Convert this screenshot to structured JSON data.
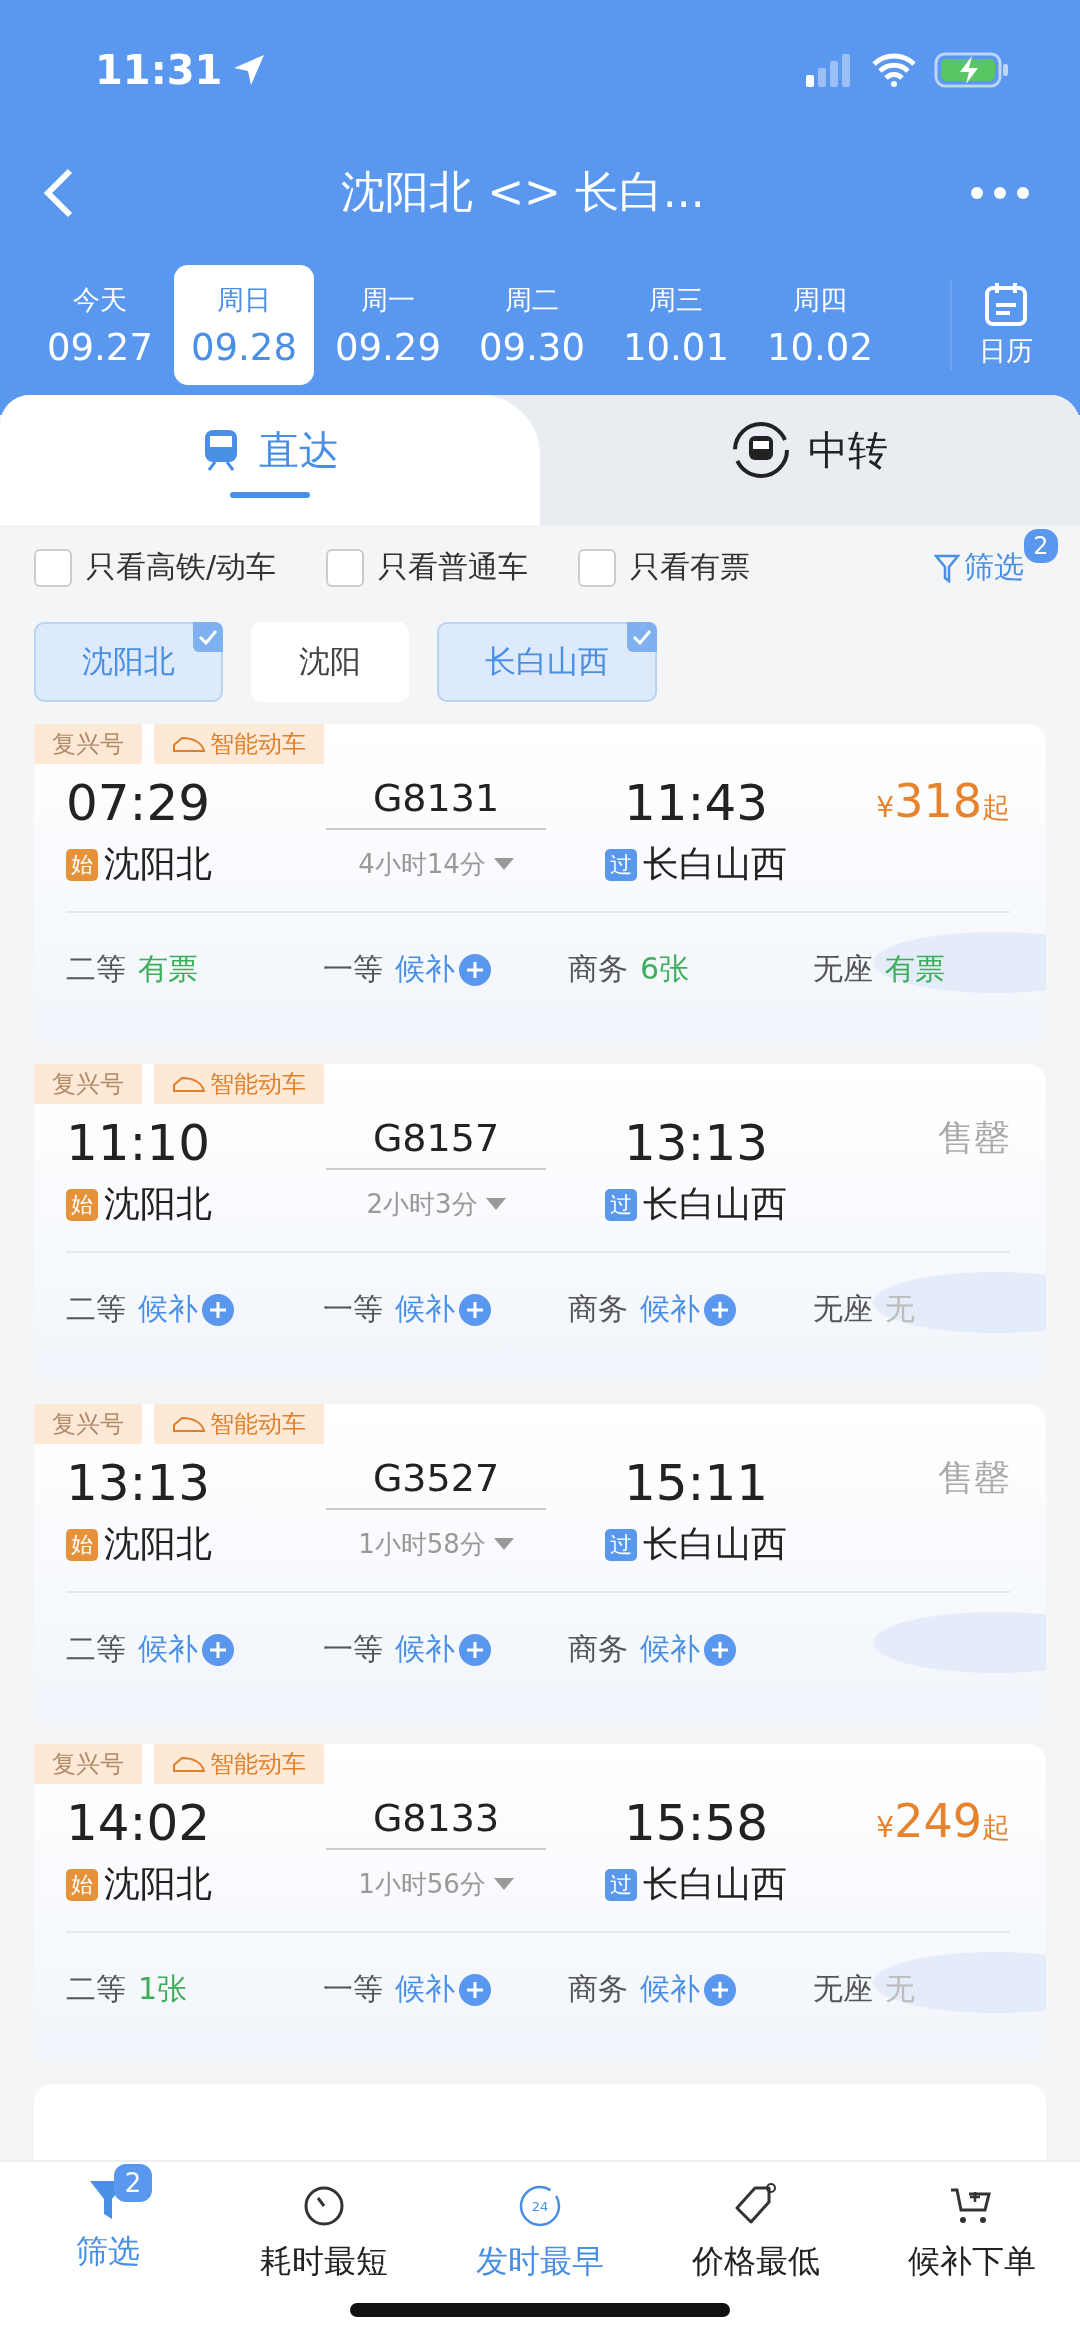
{
  "status_bar": {
    "time": "11:31"
  },
  "header": {
    "title": "沈阳北 <> 长白...",
    "calendar_label": "日历"
  },
  "dates": [
    {
      "weekday": "今天",
      "date": "09.27",
      "selected": false
    },
    {
      "weekday": "周日",
      "date": "09.28",
      "selected": true
    },
    {
      "weekday": "周一",
      "date": "09.29",
      "selected": false
    },
    {
      "weekday": "周二",
      "date": "09.30",
      "selected": false
    },
    {
      "weekday": "周三",
      "date": "10.01",
      "selected": false
    },
    {
      "weekday": "周四",
      "date": "10.02",
      "selected": false
    }
  ],
  "tabs": [
    {
      "label": "直达",
      "kind": "direct",
      "selected": true
    },
    {
      "label": "中转",
      "kind": "transfer",
      "selected": false
    }
  ],
  "filters": [
    {
      "label": "只看高铁/动车",
      "checked": false
    },
    {
      "label": "只看普通车",
      "checked": false
    },
    {
      "label": "只看有票",
      "checked": false
    }
  ],
  "filter_button": {
    "label": "筛选",
    "badge": "2"
  },
  "stations": [
    {
      "label": "沈阳北",
      "selected": true
    },
    {
      "label": "沈阳",
      "selected": false
    },
    {
      "label": "长白山西",
      "selected": true
    }
  ],
  "trains": [
    {
      "tags": [
        "复兴号",
        "智能动车"
      ],
      "depart": "07:29",
      "number": "G8131",
      "arrive": "11:43",
      "from_mark": "始",
      "from": "沈阳北",
      "duration": "4小时14分",
      "to_mark": "过",
      "to": "长白山西",
      "price": {
        "currency": "¥",
        "amount": "318",
        "suffix": "起"
      },
      "seats": [
        {
          "class": "二等",
          "status": "有票",
          "kind": "available"
        },
        {
          "class": "一等",
          "status": "候补",
          "kind": "waitlist"
        },
        {
          "class": "商务",
          "status": "6张",
          "kind": "available"
        },
        {
          "class": "无座",
          "status": "有票",
          "kind": "available"
        }
      ]
    },
    {
      "tags": [
        "复兴号",
        "智能动车"
      ],
      "depart": "11:10",
      "number": "G8157",
      "arrive": "13:13",
      "from_mark": "始",
      "from": "沈阳北",
      "duration": "2小时3分",
      "to_mark": "过",
      "to": "长白山西",
      "sold_out": "售罄",
      "seats": [
        {
          "class": "二等",
          "status": "候补",
          "kind": "waitlist"
        },
        {
          "class": "一等",
          "status": "候补",
          "kind": "waitlist"
        },
        {
          "class": "商务",
          "status": "候补",
          "kind": "waitlist"
        },
        {
          "class": "无座",
          "status": "无",
          "kind": "none"
        }
      ]
    },
    {
      "tags": [
        "复兴号",
        "智能动车"
      ],
      "depart": "13:13",
      "number": "G3527",
      "arrive": "15:11",
      "from_mark": "始",
      "from": "沈阳北",
      "duration": "1小时58分",
      "to_mark": "过",
      "to": "长白山西",
      "sold_out": "售罄",
      "seats": [
        {
          "class": "二等",
          "status": "候补",
          "kind": "waitlist"
        },
        {
          "class": "一等",
          "status": "候补",
          "kind": "waitlist"
        },
        {
          "class": "商务",
          "status": "候补",
          "kind": "waitlist"
        }
      ]
    },
    {
      "tags": [
        "复兴号",
        "智能动车"
      ],
      "depart": "14:02",
      "number": "G8133",
      "arrive": "15:58",
      "from_mark": "始",
      "from": "沈阳北",
      "duration": "1小时56分",
      "to_mark": "过",
      "to": "长白山西",
      "price": {
        "currency": "¥",
        "amount": "249",
        "suffix": "起"
      },
      "seats": [
        {
          "class": "二等",
          "status": "1张",
          "kind": "available"
        },
        {
          "class": "一等",
          "status": "候补",
          "kind": "waitlist"
        },
        {
          "class": "商务",
          "status": "候补",
          "kind": "waitlist"
        },
        {
          "class": "无座",
          "status": "无",
          "kind": "none"
        }
      ]
    }
  ],
  "bottom_nav": [
    {
      "label": "筛选",
      "kind": "filter",
      "selected": true,
      "badge": "2"
    },
    {
      "label": "耗时最短",
      "kind": "timer",
      "selected": false
    },
    {
      "label": "发时最早",
      "kind": "clock24",
      "selected": true,
      "icon_text": "24"
    },
    {
      "label": "价格最低",
      "kind": "tag",
      "selected": false
    },
    {
      "label": "候补下单",
      "kind": "cart",
      "selected": false
    }
  ]
}
